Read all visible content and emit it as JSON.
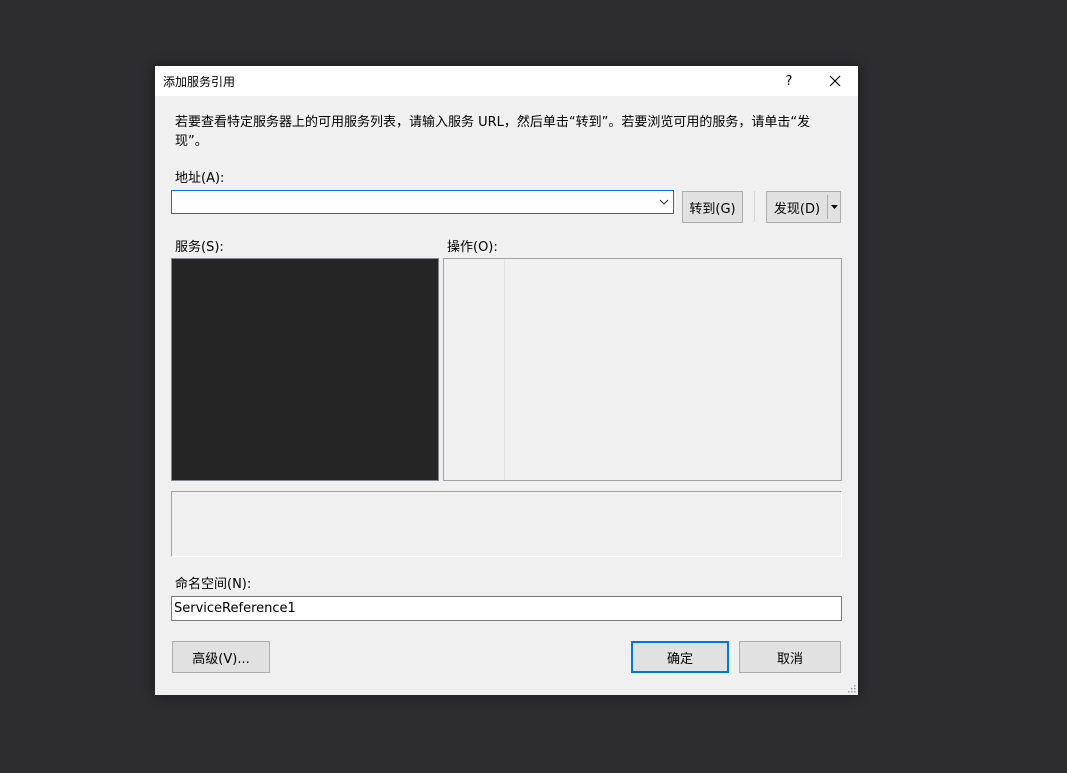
{
  "dialog": {
    "title": "添加服务引用",
    "help_glyph": "?",
    "close_icon": "close-icon",
    "description": "若要查看特定服务器上的可用服务列表，请输入服务 URL，然后单击“转到”。若要浏览可用的服务，请单击“发现”。",
    "address": {
      "label": "地址(A):",
      "value": "",
      "dropdown_icon": "chevron-down-icon"
    },
    "go_button": "转到(G)",
    "discover_button": "发现(D)",
    "discover_dropdown_icon": "caret-down-icon",
    "services_label": "服务(S):",
    "operations_label": "操作(O):",
    "namespace": {
      "label": "命名空间(N):",
      "value": "ServiceReference1"
    },
    "advanced_button": "高级(V)...",
    "ok_button": "确定",
    "cancel_button": "取消"
  },
  "colors": {
    "backdrop": "#2d2d30",
    "dialog_bg": "#f0f0f0",
    "accent": "#0078d7",
    "services_bg": "#252526"
  }
}
